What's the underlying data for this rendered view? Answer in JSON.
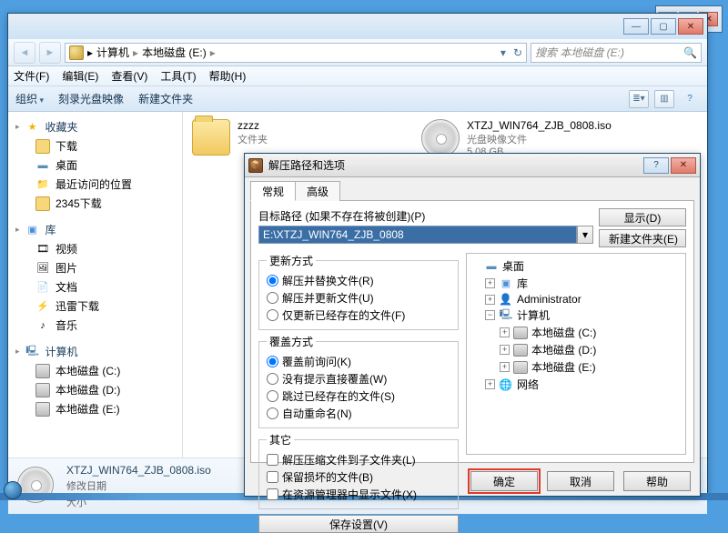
{
  "behind_window": {},
  "explorer": {
    "breadcrumb": {
      "seg1": "计算机",
      "seg2": "本地磁盘 (E:)"
    },
    "search_placeholder": "搜索 本地磁盘 (E:)",
    "menus": [
      "文件(F)",
      "编辑(E)",
      "查看(V)",
      "工具(T)",
      "帮助(H)"
    ],
    "toolbar": {
      "organize": "组织",
      "burn": "刻录光盘映像",
      "newfolder": "新建文件夹"
    },
    "sidebar": {
      "fav_head": "收藏夹",
      "fav": [
        "下载",
        "桌面",
        "最近访问的位置",
        "2345下载"
      ],
      "lib_head": "库",
      "lib": [
        "视频",
        "图片",
        "文档",
        "迅雷下载",
        "音乐"
      ],
      "pc_head": "计算机",
      "pc": [
        "本地磁盘 (C:)",
        "本地磁盘 (D:)",
        "本地磁盘 (E:)"
      ]
    },
    "files": {
      "folder": {
        "name": "zzzz",
        "meta": "文件夹"
      },
      "iso": {
        "name": "XTZJ_WIN764_ZJB_0808.iso",
        "meta1": "光盘映像文件",
        "meta2": "5.08 GB"
      }
    },
    "details": {
      "name": "XTZJ_WIN764_ZJB_0808.iso",
      "k_mod": "修改日期",
      "k_size": "大小"
    }
  },
  "dialog": {
    "title": "解压路径和选项",
    "tab_general": "常规",
    "tab_adv": "高级",
    "dest_label": "目标路径 (如果不存在将被创建)(P)",
    "dest_value": "E:\\XTZJ_WIN764_ZJB_0808",
    "btn_show": "显示(D)",
    "btn_newfolder": "新建文件夹(E)",
    "update_legend": "更新方式",
    "update_opts": [
      "解压并替换文件(R)",
      "解压并更新文件(U)",
      "仅更新已经存在的文件(F)"
    ],
    "overwrite_legend": "覆盖方式",
    "overwrite_opts": [
      "覆盖前询问(K)",
      "没有提示直接覆盖(W)",
      "跳过已经存在的文件(S)",
      "自动重命名(N)"
    ],
    "other_legend": "其它",
    "other_opts": [
      "解压压缩文件到子文件夹(L)",
      "保留损坏的文件(B)",
      "在资源管理器中显示文件(X)"
    ],
    "save_btn": "保存设置(V)",
    "tree": {
      "desktop": "桌面",
      "libs": "库",
      "admin": "Administrator",
      "computer": "计算机",
      "c": "本地磁盘 (C:)",
      "d": "本地磁盘 (D:)",
      "e": "本地磁盘 (E:)",
      "network": "网络"
    },
    "footer": {
      "ok": "确定",
      "cancel": "取消",
      "help": "帮助"
    }
  }
}
